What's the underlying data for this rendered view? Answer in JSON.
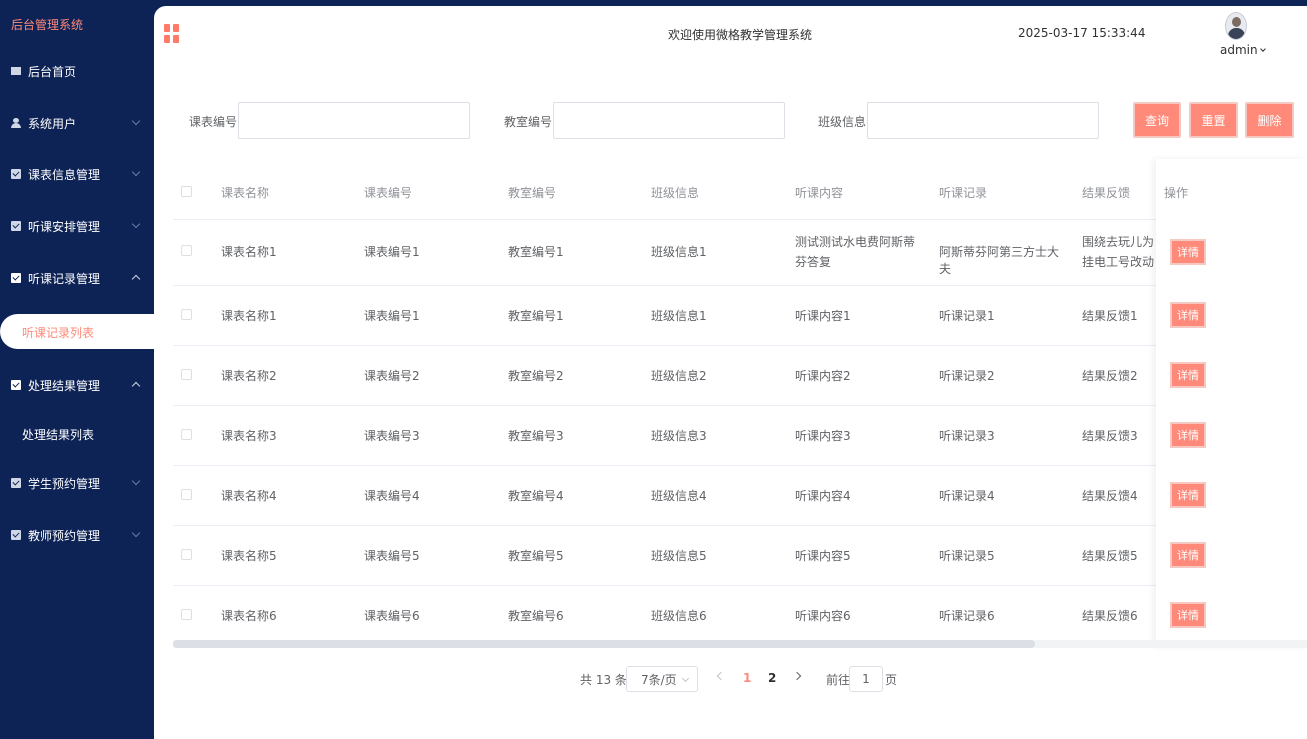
{
  "app": {
    "brand": "后台管理系统"
  },
  "sidebar": {
    "items": [
      {
        "label": "后台首页"
      },
      {
        "label": "系统用户"
      },
      {
        "label": "课表信息管理"
      },
      {
        "label": "听课安排管理"
      },
      {
        "label": "听课记录管理"
      },
      {
        "label": "处理结果管理"
      },
      {
        "label": "学生预约管理"
      },
      {
        "label": "教师预约管理"
      }
    ],
    "sub_active": "听课记录列表",
    "sub_result": "处理结果列表"
  },
  "header": {
    "welcome": "欢迎使用微格教学管理系统",
    "datetime": "2025-03-17 15:33:44",
    "user": "admin"
  },
  "search": {
    "course_code_label": "课表编号",
    "classroom_code_label": "教室编号",
    "class_info_label": "班级信息",
    "course_code_value": "",
    "classroom_code_value": "",
    "class_info_value": "",
    "query_label": "查询",
    "reset_label": "重置",
    "delete_label": "删除"
  },
  "table": {
    "headers": [
      "课表名称",
      "课表编号",
      "教室编号",
      "班级信息",
      "听课内容",
      "听课记录",
      "结果反馈",
      "操作"
    ],
    "rows": [
      [
        "课表名称1",
        "课表编号1",
        "教室编号1",
        "班级信息1",
        "测试测试水电费阿斯蒂芬答复",
        "阿斯蒂芬阿第三方士大夫",
        "围绕去玩儿为挂电工号改动"
      ],
      [
        "课表名称1",
        "课表编号1",
        "教室编号1",
        "班级信息1",
        "听课内容1",
        "听课记录1",
        "结果反馈1"
      ],
      [
        "课表名称2",
        "课表编号2",
        "教室编号2",
        "班级信息2",
        "听课内容2",
        "听课记录2",
        "结果反馈2"
      ],
      [
        "课表名称3",
        "课表编号3",
        "教室编号3",
        "班级信息3",
        "听课内容3",
        "听课记录3",
        "结果反馈3"
      ],
      [
        "课表名称4",
        "课表编号4",
        "教室编号4",
        "班级信息4",
        "听课内容4",
        "听课记录4",
        "结果反馈4"
      ],
      [
        "课表名称5",
        "课表编号5",
        "教室编号5",
        "班级信息5",
        "听课内容5",
        "听课记录5",
        "结果反馈5"
      ],
      [
        "课表名称6",
        "课表编号6",
        "教室编号6",
        "班级信息6",
        "听课内容6",
        "听课记录6",
        "结果反馈6"
      ]
    ],
    "detail_label": "详情"
  },
  "pagination": {
    "total": "共 13 条",
    "page_size": "7条/页",
    "pages": [
      "1",
      "2"
    ],
    "current_page": "1",
    "goto_label": "前往",
    "goto_value": "1",
    "page_unit": "页"
  },
  "colors": {
    "accent": "#ff8a7a",
    "sidebar": "#0d2255"
  }
}
